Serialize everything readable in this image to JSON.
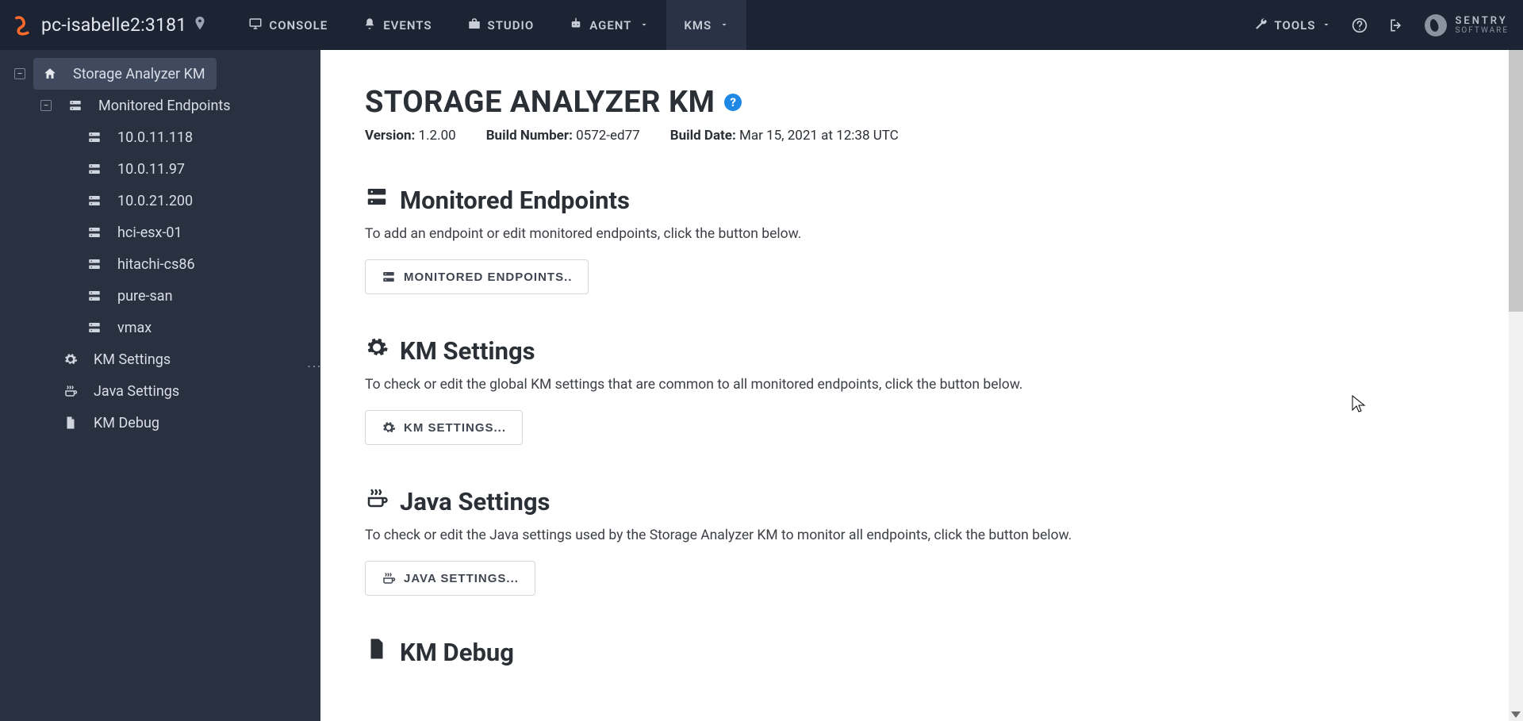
{
  "header": {
    "host": "pc-isabelle2:3181",
    "nav": {
      "console": "CONSOLE",
      "events": "EVENTS",
      "studio": "STUDIO",
      "agent": "AGENT",
      "kms": "KMs"
    },
    "tools_label": "TOOLS",
    "brand_top": "SENTRY",
    "brand_bottom": "SOFTWARE"
  },
  "sidebar": {
    "root": "Storage Analyzer KM",
    "endpoints_label": "Monitored Endpoints",
    "endpoints": [
      "10.0.11.118",
      "10.0.11.97",
      "10.0.21.200",
      "hci-esx-01",
      "hitachi-cs86",
      "pure-san",
      "vmax"
    ],
    "km_settings": "KM Settings",
    "java_settings": "Java Settings",
    "km_debug": "KM Debug"
  },
  "page": {
    "title": "STORAGE ANALYZER KM",
    "version_label": "Version:",
    "version": "1.2.00",
    "build_label": "Build Number:",
    "build": "0572-ed77",
    "date_label": "Build Date:",
    "date": "Mar 15, 2021 at 12:38 UTC",
    "sections": {
      "endpoints": {
        "title": "Monitored Endpoints",
        "desc": "To add an endpoint or edit monitored endpoints, click the button below.",
        "button": "MONITORED ENDPOINTS.."
      },
      "km": {
        "title": "KM Settings",
        "desc": "To check or edit the global KM settings that are common to all monitored endpoints, click the button below.",
        "button": "KM SETTINGS..."
      },
      "java": {
        "title": "Java Settings",
        "desc": "To check or edit the Java settings used by the Storage Analyzer KM to monitor all endpoints, click the button below.",
        "button": "JAVA SETTINGS..."
      },
      "debug": {
        "title": "KM Debug"
      }
    }
  }
}
